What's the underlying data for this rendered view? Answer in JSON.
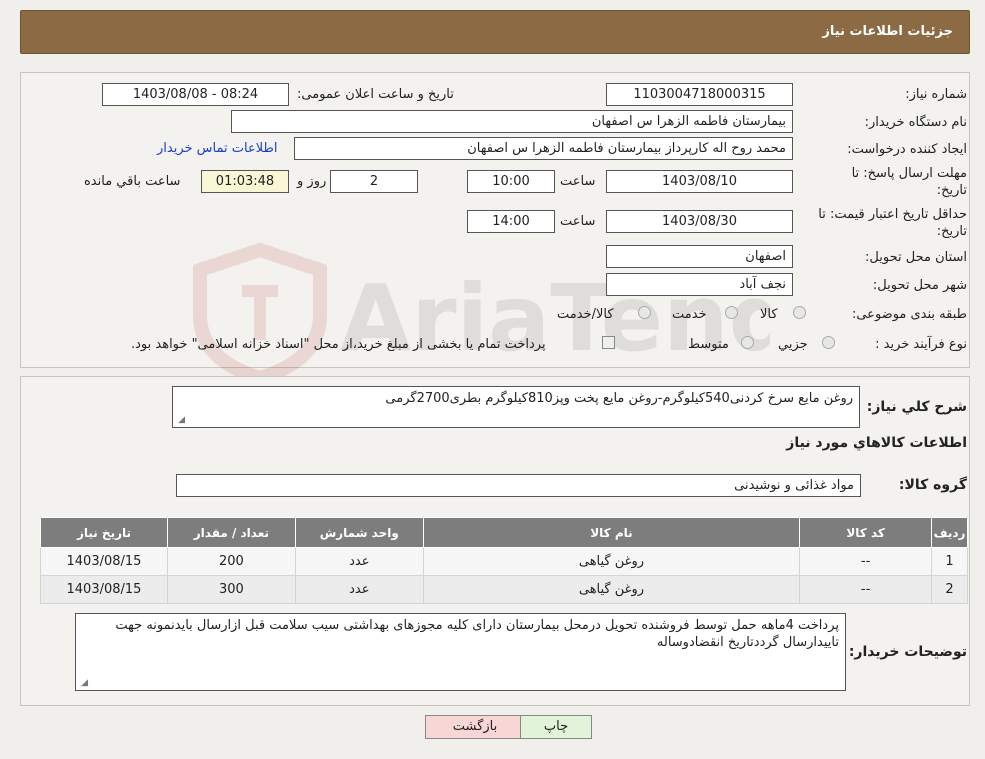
{
  "header": {
    "title": "جزئیات اطلاعات نیاز"
  },
  "form": {
    "need_number_label": "شماره نیاز:",
    "need_number": "1103004718000315",
    "announce_label": "تاریخ و ساعت اعلان عمومی:",
    "announce_value": "1403/08/08 - 08:24",
    "buyer_org_label": "نام دستگاه خریدار:",
    "buyer_org": "بیمارستان فاطمه الزهرا س  اصفهان",
    "creator_label": "ایجاد کننده درخواست:",
    "creator": "محمد روح اله کارپرداز بیمارستان فاطمه الزهرا س  اصفهان",
    "contact_link": "اطلاعات تماس خریدار",
    "deadline_label_1": "مهلت ارسال پاسخ: تا",
    "deadline_label_2": "تاریخ:",
    "deadline_date": "1403/08/10",
    "time_label": "ساعت",
    "deadline_time": "10:00",
    "days_value": "2",
    "days_label": "روز و",
    "remaining_time": "01:03:48",
    "remaining_label": "ساعت باقي مانده",
    "validity_label_1": "حداقل تاریخ اعتبار قیمت: تا",
    "validity_label_2": "تاریخ:",
    "validity_date": "1403/08/30",
    "validity_time_label": "ساعت",
    "validity_time": "14:00",
    "province_label": "استان محل تحویل:",
    "province": "اصفهان",
    "city_label": "شهر محل تحویل:",
    "city": "نجف آباد",
    "category_label": "طبقه بندی موضوعی:",
    "category_options": [
      "کالا",
      "خدمت",
      "کالا/خدمت"
    ],
    "process_label": "نوع فرآیند خرید :",
    "process_options": [
      "جزيي",
      "متوسط"
    ],
    "process_note": "پرداخت تمام یا بخشی از مبلغ خرید،از محل \"اسناد خزانه اسلامی\" خواهد بود."
  },
  "details": {
    "summary_label": "شرح کلي نياز:",
    "summary": "روغن مایع سرخ کردنی540کیلوگرم-روغن مایع پخت وپز810کیلوگرم بطری2700گرمی",
    "goods_info_title": "اطلاعات کالاهاي مورد نياز",
    "group_label": "گروه کالا:",
    "group_value": "مواد غذائی و نوشیدنی",
    "table": {
      "headers": [
        "رديف",
        "کد کالا",
        "نام کالا",
        "واحد شمارش",
        "تعداد / مقدار",
        "تاريخ نياز"
      ],
      "rows": [
        [
          "1",
          "--",
          "روغن گیاهی",
          "عدد",
          "200",
          "1403/08/15"
        ],
        [
          "2",
          "--",
          "روغن گیاهی",
          "عدد",
          "300",
          "1403/08/15"
        ]
      ]
    },
    "notes_label": "توضیحات خریدار:",
    "notes": "پرداخت 4ماهه حمل توسط فروشنده تحویل درمحل بیمارستان دارای کلیه مجوزهای بهداشتی سیب سلامت قبل ازارسال بایدنمونه جهت تاییدارسال گرددتاریخ انقضادوساله"
  },
  "buttons": {
    "back": "بازگشت",
    "print": "چاپ"
  },
  "watermark": {
    "text": "AriaTender.neT"
  }
}
